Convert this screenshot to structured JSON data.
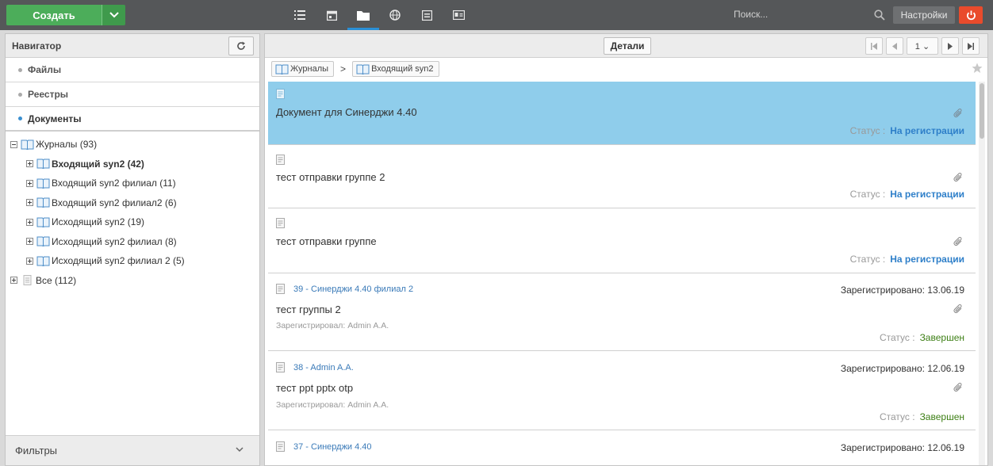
{
  "topbar": {
    "create_label": "Создать",
    "nav_icons": [
      "list-icon",
      "calendar-icon",
      "folder-icon",
      "globe-icon",
      "document-icon",
      "contact-card-icon"
    ],
    "active_icon": "folder-icon",
    "search_placeholder": "Поиск...",
    "settings_label": "Настройки",
    "colors": {
      "bar": "#555759",
      "create": "#4cad5a",
      "power": "#e94b2c",
      "active_underline": "#2a8fd6"
    }
  },
  "navigator": {
    "title": "Навигатор",
    "sections": [
      "Файлы",
      "Реестры",
      "Документы"
    ],
    "active_section": "Документы",
    "tree": [
      {
        "label": "Журналы (93)",
        "level": 0,
        "expanded": true,
        "icon": "book-icon"
      },
      {
        "label": "Входящий syn2 (42)",
        "level": 1,
        "bold": true,
        "icon": "book-icon"
      },
      {
        "label": "Входящий syn2 филиал (11)",
        "level": 1,
        "icon": "book-icon"
      },
      {
        "label": "Входящий syn2 филиал2 (6)",
        "level": 1,
        "icon": "book-icon"
      },
      {
        "label": "Исходящий syn2 (19)",
        "level": 1,
        "icon": "book-icon"
      },
      {
        "label": "Исходящий syn2 филиал (8)",
        "level": 1,
        "icon": "book-icon"
      },
      {
        "label": "Исходящий syn2 филиал 2 (5)",
        "level": 1,
        "icon": "book-icon"
      },
      {
        "label": "Все (112)",
        "level": 0,
        "icon": "list-doc-icon"
      }
    ],
    "filters_label": "Фильтры"
  },
  "toolbar": {
    "details_label": "Детали",
    "page": "1 ⌄"
  },
  "breadcrumbs": [
    "Журналы",
    "Входящий syn2"
  ],
  "documents": [
    {
      "title": "Документ для Синерджи 4.40",
      "status_label": "Статус :",
      "status": "На регистрации",
      "selected": true
    },
    {
      "title": "тест отправки группе 2",
      "status_label": "Статус :",
      "status": "На регистрации"
    },
    {
      "title": "тест отправки группе",
      "status_label": "Статус :",
      "status": "На регистрации"
    },
    {
      "reg_line": "39 - Синерджи 4.40 филиал 2",
      "reg_date": "Зарегистрировано: 13.06.19",
      "title": "тест группы 2",
      "reg_by": "Зарегистрировал: Admin A.A.",
      "status_label": "Статус :",
      "status": "Завершен"
    },
    {
      "reg_line": "38 - Admin A.A.",
      "reg_date": "Зарегистрировано: 12.06.19",
      "title": "тест ppt pptx otp",
      "reg_by": "Зарегистрировал: Admin A.A.",
      "status_label": "Статус :",
      "status": "Завершен"
    },
    {
      "reg_line": "37 - Синерджи 4.40",
      "reg_date": "Зарегистрировано: 12.06.19"
    }
  ]
}
